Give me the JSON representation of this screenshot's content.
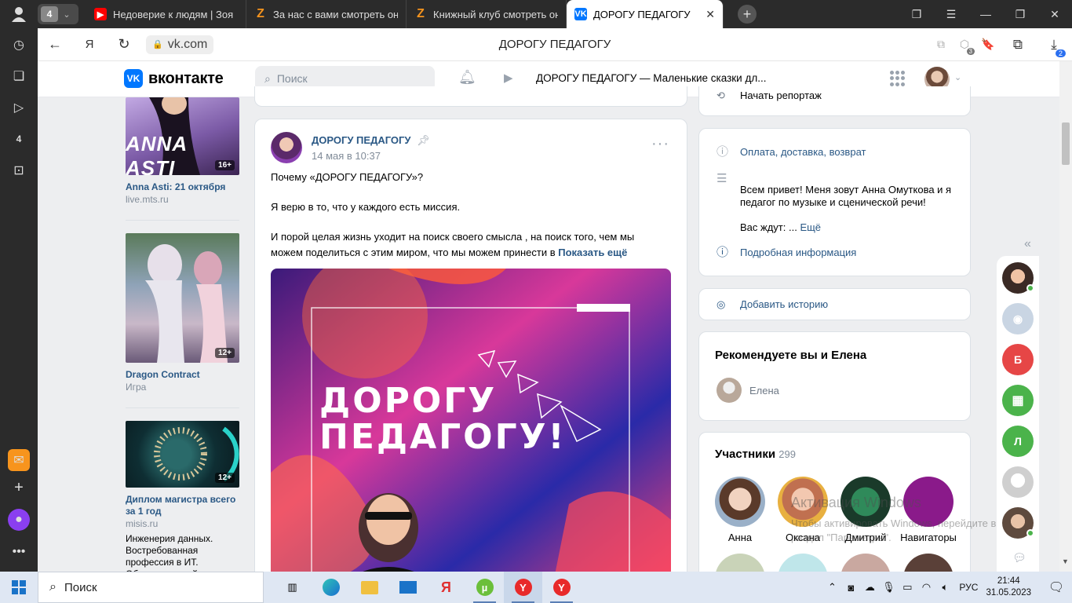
{
  "browser": {
    "profile_icon": "person-icon",
    "tab_count": "4",
    "tabs": [
      {
        "title": "Недоверие к людям | Зоя",
        "favicon": "youtube-icon"
      },
      {
        "title": "За нас с вами смотреть онлайн",
        "favicon": "zona-icon"
      },
      {
        "title": "Книжный клуб смотреть онлайн",
        "favicon": "zona-icon"
      },
      {
        "title": "ДОРОГУ ПЕДАГОГУ",
        "favicon": "vk-icon"
      }
    ],
    "url": "vk.com",
    "page_title": "ДОРОГУ ПЕДАГОГУ",
    "extensions_badge": "3",
    "downloads_badge": "2"
  },
  "vk_header": {
    "logo_text": "вконтакте",
    "search_placeholder": "Поиск",
    "now_playing": "ДОРОГУ ПЕДАГОГУ — Маленькие сказки дл..."
  },
  "ads": [
    {
      "title": "Anna Asti: 21 октября",
      "source": "live.mts.ru",
      "age": "16+",
      "image_text": "ANNA ASTI"
    },
    {
      "title": "Dragon Contract",
      "source": "Игра",
      "age": "12+"
    },
    {
      "title": "Диплом магистра всего за 1 год",
      "source": "misis.ru",
      "age": "12+",
      "description": "Инженерия данных. Востребованная профессия в ИТ. Обучение онлайн"
    }
  ],
  "post": {
    "author": "ДОРОГУ ПЕДАГОГУ",
    "date": "14 мая в 10:37",
    "paragraphs": [
      "Почему «ДОРОГУ ПЕДАГОГУ»?",
      "Я верю в то, что у каждого есть миссия.",
      "И порой целая жизнь уходит на поиск своего смысла , на поиск того, чем мы можем поделиться с этим миром, что мы можем принести в"
    ],
    "show_more": "Показать ещё",
    "image_line1": "ДОРОГУ",
    "image_line2": "ПЕДАГОГУ!"
  },
  "right": {
    "top_partial": "Начать репортаж",
    "info_link": "Оплата, доставка, возврат",
    "description": "Всем привет! Меня зовут Анна Омуткова и я педагог по музыке и сценической речи!",
    "waiting": "Вас ждут: ...",
    "more": "Ещё",
    "details": "Подробная информация",
    "add_story": "Добавить историю",
    "recommend_title": "Рекомендуете вы и Елена",
    "recommend_name": "Елена",
    "members_title": "Участники",
    "members_count": "299",
    "members": [
      "Анна",
      "Оксана",
      "Дмитрий",
      "Навигаторы"
    ],
    "activation_line1": "Активация Windows",
    "activation_line2": "Чтобы активировать Windows, перейдите в",
    "activation_line3": "раздел \"Параметры\"."
  },
  "chats": [
    {
      "letter": "",
      "color": "#3a2a25"
    },
    {
      "letter": "",
      "color": "#c9d5e3"
    },
    {
      "letter": "Б",
      "color": "#e64646"
    },
    {
      "letter": "",
      "color": "#4bb34b"
    },
    {
      "letter": "Л",
      "color": "#4bb34b"
    },
    {
      "letter": "",
      "color": "#d8d8d8"
    },
    {
      "letter": "",
      "color": "#5e4a3e"
    }
  ],
  "taskbar": {
    "search_placeholder": "Поиск",
    "language": "РУС",
    "time": "21:44",
    "date": "31.05.2023"
  }
}
